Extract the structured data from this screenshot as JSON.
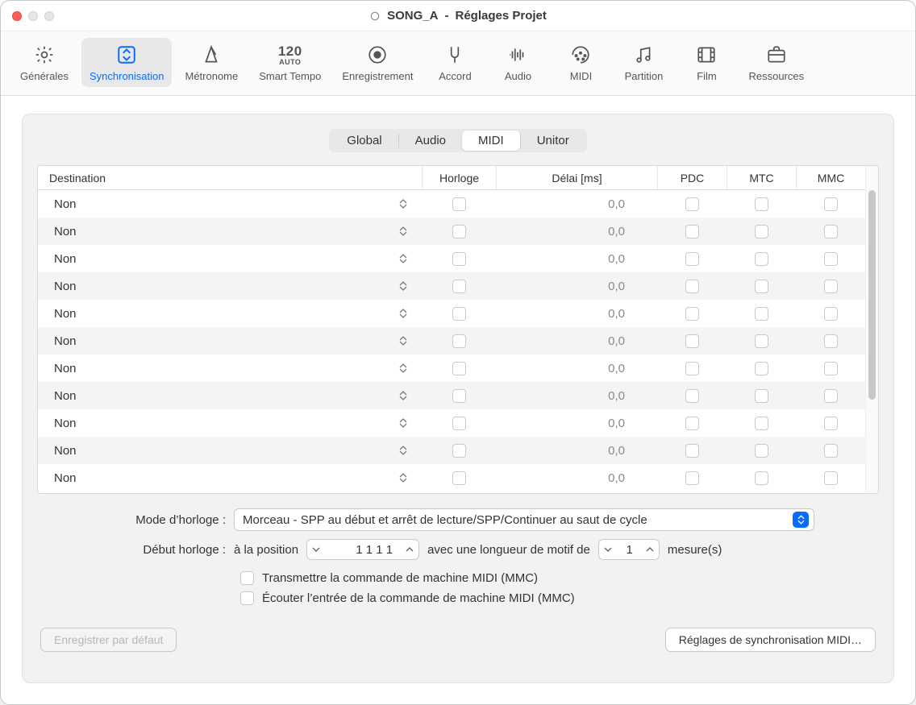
{
  "window": {
    "title_main": "SONG_A",
    "title_sub": "Réglages Projet"
  },
  "toolbar": {
    "items": [
      {
        "id": "general",
        "label": "Générales"
      },
      {
        "id": "sync",
        "label": "Synchronisation",
        "active": true
      },
      {
        "id": "metronome",
        "label": "Métronome"
      },
      {
        "id": "smart_tempo",
        "label": "Smart Tempo",
        "tempo": "120",
        "auto": "AUTO"
      },
      {
        "id": "recording",
        "label": "Enregistrement"
      },
      {
        "id": "chord",
        "label": "Accord"
      },
      {
        "id": "audio",
        "label": "Audio"
      },
      {
        "id": "midi",
        "label": "MIDI"
      },
      {
        "id": "score",
        "label": "Partition"
      },
      {
        "id": "movie",
        "label": "Film"
      },
      {
        "id": "assets",
        "label": "Ressources"
      }
    ]
  },
  "segments": {
    "items": [
      "Global",
      "Audio",
      "MIDI",
      "Unitor"
    ],
    "selected": "MIDI"
  },
  "table": {
    "headers": {
      "destination": "Destination",
      "horloge": "Horloge",
      "delai": "Délai [ms]",
      "pdc": "PDC",
      "mtc": "MTC",
      "mmc": "MMC"
    },
    "rows": [
      {
        "dest": "Non",
        "delai": "0,0"
      },
      {
        "dest": "Non",
        "delai": "0,0"
      },
      {
        "dest": "Non",
        "delai": "0,0"
      },
      {
        "dest": "Non",
        "delai": "0,0"
      },
      {
        "dest": "Non",
        "delai": "0,0"
      },
      {
        "dest": "Non",
        "delai": "0,0"
      },
      {
        "dest": "Non",
        "delai": "0,0"
      },
      {
        "dest": "Non",
        "delai": "0,0"
      },
      {
        "dest": "Non",
        "delai": "0,0"
      },
      {
        "dest": "Non",
        "delai": "0,0"
      },
      {
        "dest": "Non",
        "delai": "0,0"
      }
    ]
  },
  "form": {
    "clock_mode_label": "Mode d’horloge :",
    "clock_mode_value": "Morceau - SPP au début et arrêt de lecture/SPP/Continuer au saut de cycle",
    "clock_start_label": "Début horloge :",
    "clock_start_prefix": "à la position",
    "clock_start_position": "1  1  1      1",
    "clock_start_middle": "avec une longueur de motif de",
    "clock_start_pattern": "1",
    "clock_start_suffix": "mesure(s)",
    "mmc_transmit": "Transmettre la commande de machine MIDI (MMC)",
    "mmc_listen": "Écouter l’entrée de la commande de machine MIDI (MMC)"
  },
  "footer": {
    "save_default": "Enregistrer par défaut",
    "midi_sync_settings": "Réglages de synchronisation MIDI…"
  }
}
